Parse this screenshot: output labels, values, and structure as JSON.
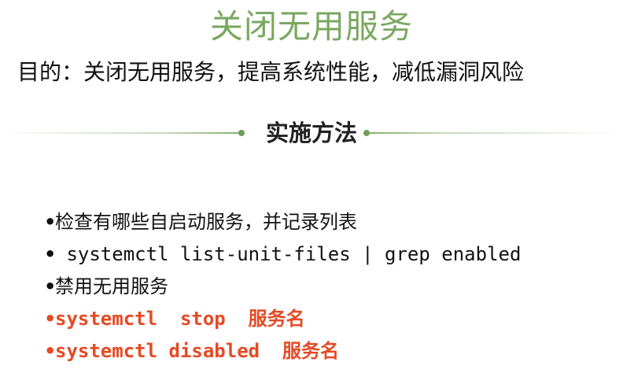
{
  "slide": {
    "title": "关闭无用服务",
    "purpose": "目的：关闭无用服务，提高系统性能，减低漏洞风险",
    "section_heading": "实施方法",
    "items": [
      {
        "bullet": "•",
        "text": "检查有哪些自启动服务，并记录列表"
      },
      {
        "bullet": "•",
        "text": " systemctl list-unit-files | grep enabled"
      },
      {
        "bullet": "•",
        "text": "禁用无用服务"
      },
      {
        "bullet": "•",
        "command": "systemctl  stop  ",
        "arg": "服务名"
      },
      {
        "bullet": "•",
        "command": "systemctl disabled  ",
        "arg": "服务名"
      }
    ]
  },
  "colors": {
    "title": "#7aa860",
    "accent_red": "#e54a24",
    "divider": "#6f9e55",
    "text": "#111111"
  }
}
